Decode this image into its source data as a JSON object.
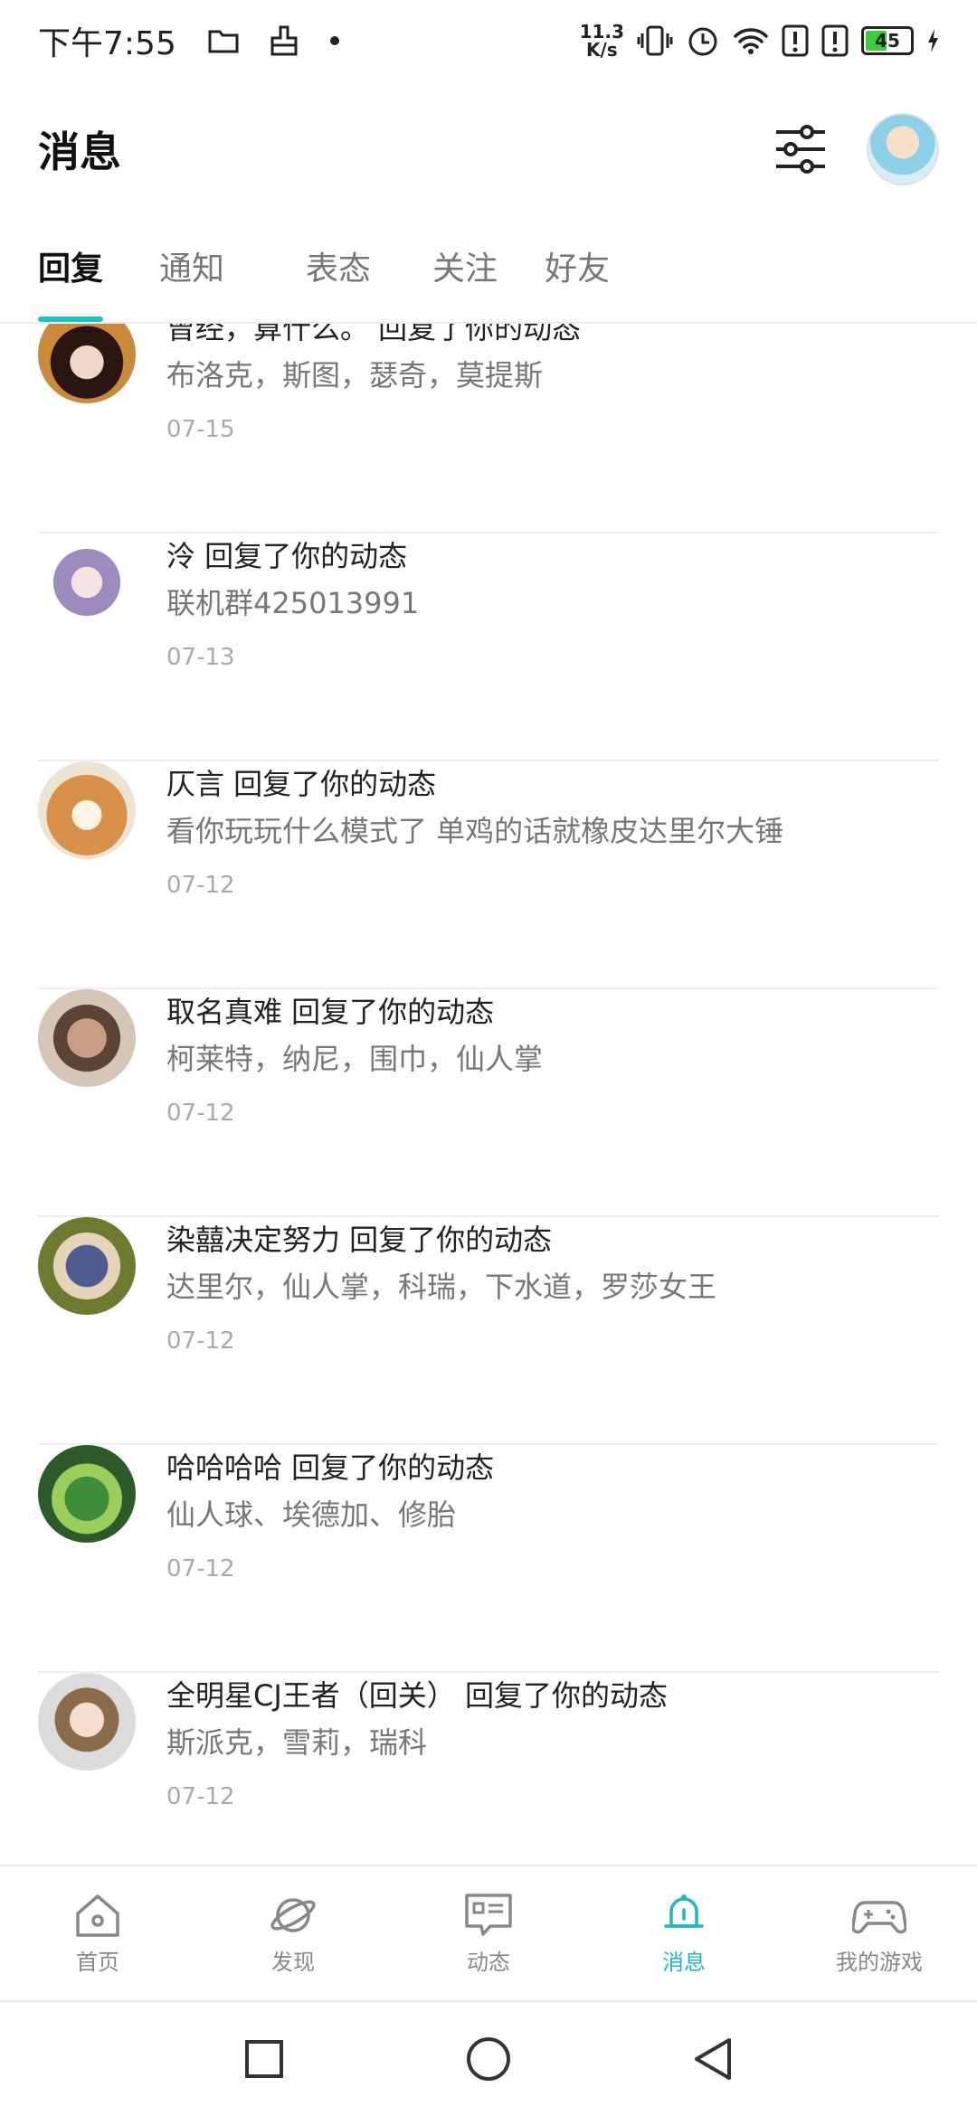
{
  "status_bar": {
    "time": "下午7:55",
    "net_speed_value": "11.3",
    "net_speed_unit": "K/s",
    "battery": "45"
  },
  "header": {
    "title": "消息"
  },
  "tabs": [
    {
      "label": "回复",
      "active": true
    },
    {
      "label": "通知",
      "active": false
    },
    {
      "label": "表态",
      "active": false
    },
    {
      "label": "关注",
      "active": false
    },
    {
      "label": "好友",
      "active": false
    }
  ],
  "messages": [
    {
      "title": "曾经，算什么。 回复了你的动态",
      "content": "布洛克，斯图，瑟奇，莫提斯",
      "date": "07-15"
    },
    {
      "title": "泠 回复了你的动态",
      "content": "联机群425013991",
      "date": "07-13"
    },
    {
      "title": "仄言 回复了你的动态",
      "content": "看你玩玩什么模式了 单鸡的话就橡皮达里尔大锤",
      "date": "07-12"
    },
    {
      "title": "取名真难 回复了你的动态",
      "content": "柯莱特，纳尼，围巾，仙人掌",
      "date": "07-12"
    },
    {
      "title": "染囍决定努力 回复了你的动态",
      "content": "达里尔，仙人掌，科瑞，下水道，罗莎女王",
      "date": "07-12"
    },
    {
      "title": "哈哈哈哈 回复了你的动态",
      "content": "仙人球、埃德加、修胎",
      "date": "07-12"
    },
    {
      "title": "全明星CJ王者（回关） 回复了你的动态",
      "content": "斯派克，雪莉，瑞科",
      "date": "07-12"
    }
  ],
  "bottom_nav": [
    {
      "label": "首页",
      "icon": "home-icon",
      "active": false
    },
    {
      "label": "发现",
      "icon": "planet-icon",
      "active": false
    },
    {
      "label": "动态",
      "icon": "feed-icon",
      "active": false
    },
    {
      "label": "消息",
      "icon": "bell-icon",
      "active": true
    },
    {
      "label": "我的游戏",
      "icon": "gamepad-icon",
      "active": false
    }
  ],
  "colors": {
    "accent": "#1fc1c3",
    "text_primary": "#222222",
    "text_secondary": "#777777",
    "text_muted": "#aaaaaa"
  }
}
